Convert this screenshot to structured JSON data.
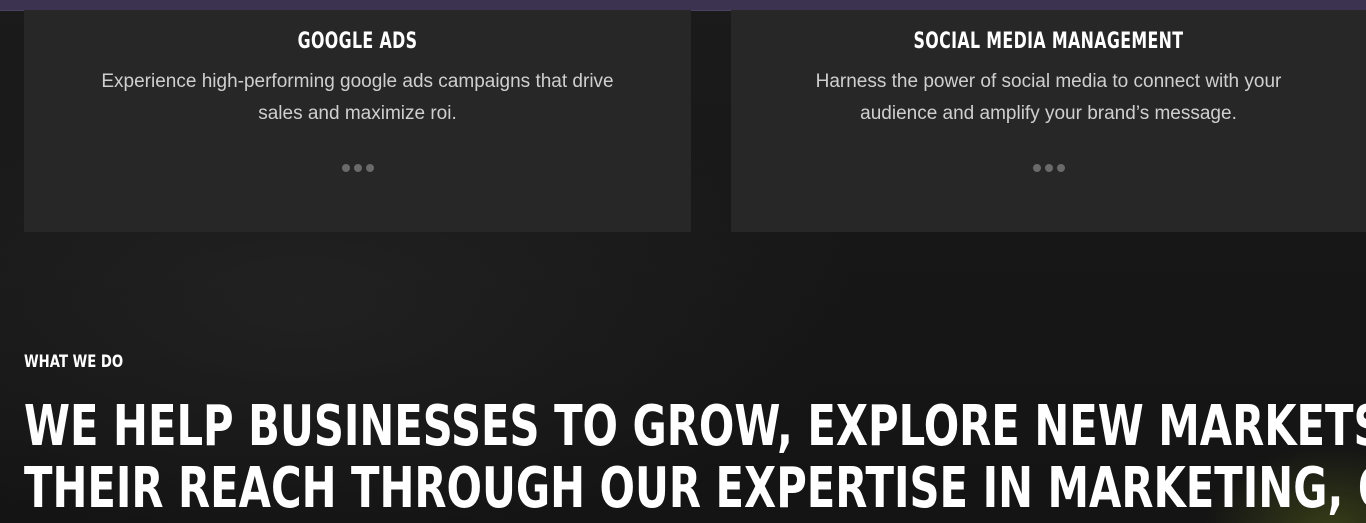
{
  "services": [
    {
      "title": "GOOGLE ADS",
      "description_line1": "Experience high-performing google ads campaigns that drive",
      "description_line2": "sales and maximize roi."
    },
    {
      "title": "SOCIAL MEDIA MANAGEMENT",
      "description_line1": "Harness the power of social media to connect with your",
      "description_line2": "audience and amplify your brand’s message."
    }
  ],
  "section": {
    "eyebrow": "WHAT WE DO",
    "headline_line1": "WE HELP BUSINESSES TO GROW, EXPLORE NEW MARKETS, AND EXPAND",
    "headline_line2": "THEIR REACH THROUGH OUR EXPERTISE IN MARKETING, ONLINE"
  },
  "icons": {
    "more": "ellipsis-icon"
  },
  "colors": {
    "top_bar": "#3c3350",
    "card_bg": "#272727",
    "page_bg": "#181818"
  }
}
